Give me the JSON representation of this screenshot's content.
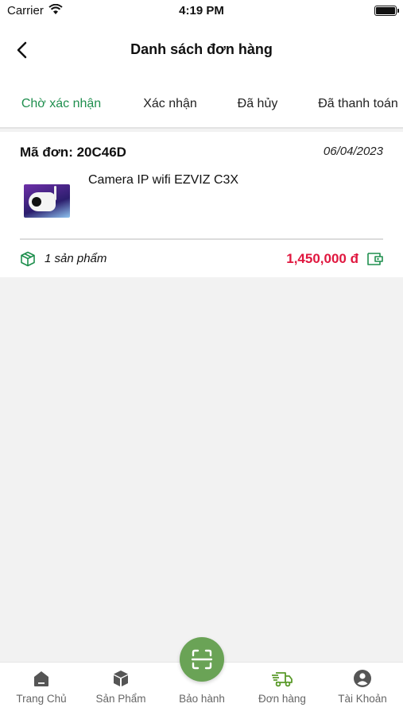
{
  "status_bar": {
    "carrier": "Carrier",
    "time": "4:19 PM"
  },
  "header": {
    "title": "Danh sách đơn hàng",
    "back_icon": "chevron-left-icon"
  },
  "tabs": [
    {
      "label": "Chờ xác nhận",
      "active": true
    },
    {
      "label": "Xác nhận",
      "active": false
    },
    {
      "label": "Đã hủy",
      "active": false
    },
    {
      "label": "Đã thanh toán",
      "active": false
    }
  ],
  "order": {
    "code": "Mã đơn: 20C46D",
    "date": "06/04/2023",
    "product_name": "Camera IP wifi EZVIZ C3X",
    "quantity": "1 sản phẩm",
    "total": "1,450,000 đ"
  },
  "bottom_nav": [
    {
      "label": "Trang Chủ",
      "icon": "home-icon",
      "active": false
    },
    {
      "label": "Sản Phẩm",
      "icon": "box-icon",
      "active": false
    },
    {
      "label": "Bảo hành",
      "icon": "scan-icon",
      "active": false
    },
    {
      "label": "Đơn hàng",
      "icon": "delivery-truck-icon",
      "active": true
    },
    {
      "label": "Tài Khoản",
      "icon": "user-icon",
      "active": false
    }
  ],
  "colors": {
    "accent_green": "#1f8f4e",
    "nav_active": "#5a9a2a",
    "price_red": "#e0173f",
    "fab_green": "#6aa356"
  }
}
